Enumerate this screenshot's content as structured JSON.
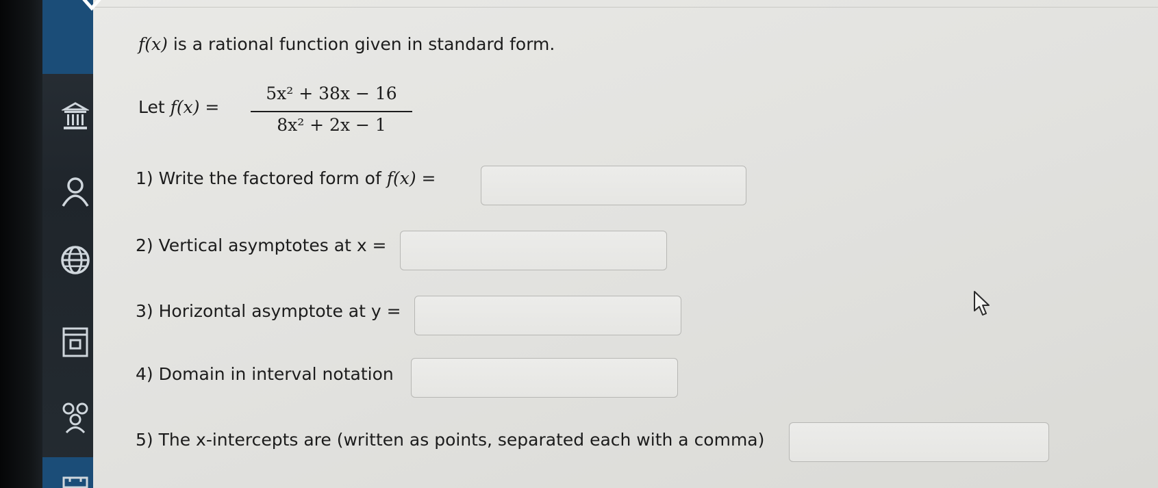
{
  "intro": {
    "fx": "f(x)",
    "text": "is a rational function given in standard form."
  },
  "definition": {
    "let_label": "Let",
    "fx": "f(x) =",
    "numerator": "5x² + 38x − 16",
    "denominator": "8x² + 2x − 1"
  },
  "questions": [
    {
      "label": "1) Write the factored form of",
      "math": "f(x) =",
      "value": "",
      "placeholder": ""
    },
    {
      "label": "2) Vertical asymptotes at x =",
      "value": "",
      "placeholder": ""
    },
    {
      "label": "3) Horizontal asymptote at y =",
      "value": "",
      "placeholder": ""
    },
    {
      "label": "4) Domain in interval notation",
      "value": "",
      "placeholder": ""
    },
    {
      "label": "5) The x-intercepts are (written as points, separated each with a comma)",
      "value": "",
      "placeholder": ""
    }
  ],
  "sidebar": {
    "items": [
      {
        "icon": "institution-icon"
      },
      {
        "icon": "user-icon"
      },
      {
        "icon": "globe-icon"
      },
      {
        "icon": "calendar-icon"
      },
      {
        "icon": "group-icon"
      },
      {
        "icon": "inbox-icon"
      }
    ],
    "close_icon": "close-icon"
  },
  "colors": {
    "sidebar_accent": "#1b4d78",
    "sidebar_bg": "#242b31",
    "content_bg": "#e6e6e3",
    "box_border": "#b7b7b4"
  }
}
